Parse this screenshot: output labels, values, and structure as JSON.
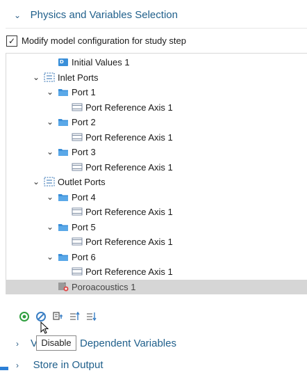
{
  "section": {
    "title": "Physics and Variables Selection"
  },
  "modify_checkbox": {
    "label": "Modify model configuration for study step",
    "checked": true
  },
  "tree": [
    {
      "label": "Initial Values 1",
      "icon": "initial-values-icon",
      "depth": 2,
      "toggle": ""
    },
    {
      "label": "Inlet Ports",
      "icon": "ports-group-icon",
      "depth": 1,
      "toggle": "expanded"
    },
    {
      "label": "Port 1",
      "icon": "port-icon",
      "depth": 2,
      "toggle": "expanded"
    },
    {
      "label": "Port Reference Axis 1",
      "icon": "reference-axis-icon",
      "depth": 3,
      "toggle": ""
    },
    {
      "label": "Port 2",
      "icon": "port-icon",
      "depth": 2,
      "toggle": "expanded"
    },
    {
      "label": "Port Reference Axis 1",
      "icon": "reference-axis-icon",
      "depth": 3,
      "toggle": ""
    },
    {
      "label": "Port 3",
      "icon": "port-icon",
      "depth": 2,
      "toggle": "expanded"
    },
    {
      "label": "Port Reference Axis 1",
      "icon": "reference-axis-icon",
      "depth": 3,
      "toggle": ""
    },
    {
      "label": "Outlet Ports",
      "icon": "ports-group-icon",
      "depth": 1,
      "toggle": "expanded"
    },
    {
      "label": "Port 4",
      "icon": "port-icon",
      "depth": 2,
      "toggle": "expanded"
    },
    {
      "label": "Port Reference Axis 1",
      "icon": "reference-axis-icon",
      "depth": 3,
      "toggle": ""
    },
    {
      "label": "Port 5",
      "icon": "port-icon",
      "depth": 2,
      "toggle": "expanded"
    },
    {
      "label": "Port Reference Axis 1",
      "icon": "reference-axis-icon",
      "depth": 3,
      "toggle": ""
    },
    {
      "label": "Port 6",
      "icon": "port-icon",
      "depth": 2,
      "toggle": "expanded"
    },
    {
      "label": "Port Reference Axis 1",
      "icon": "reference-axis-icon",
      "depth": 3,
      "toggle": ""
    },
    {
      "label": "Poroacoustics 1",
      "icon": "poroacoustics-disabled-icon",
      "depth": 2,
      "toggle": "",
      "selected": true,
      "disabled": true
    }
  ],
  "toolbar": {
    "buttons": [
      "enable-icon",
      "disable-icon",
      "override-icon",
      "move-up-icon",
      "move-down-icon"
    ]
  },
  "tooltip": {
    "text": "Disable"
  },
  "collapsed_sections": [
    {
      "label": "Values of Dependent Variables",
      "visible_prefix": "V",
      "visible_suffix": "Dependent Variables"
    },
    {
      "label": "Store in Output"
    }
  ],
  "colors": {
    "accent": "#1f5f8b",
    "selected_row": "#d6d6d6",
    "port_blue": "#3a8fd9",
    "enable_green": "#2e9e3e"
  }
}
